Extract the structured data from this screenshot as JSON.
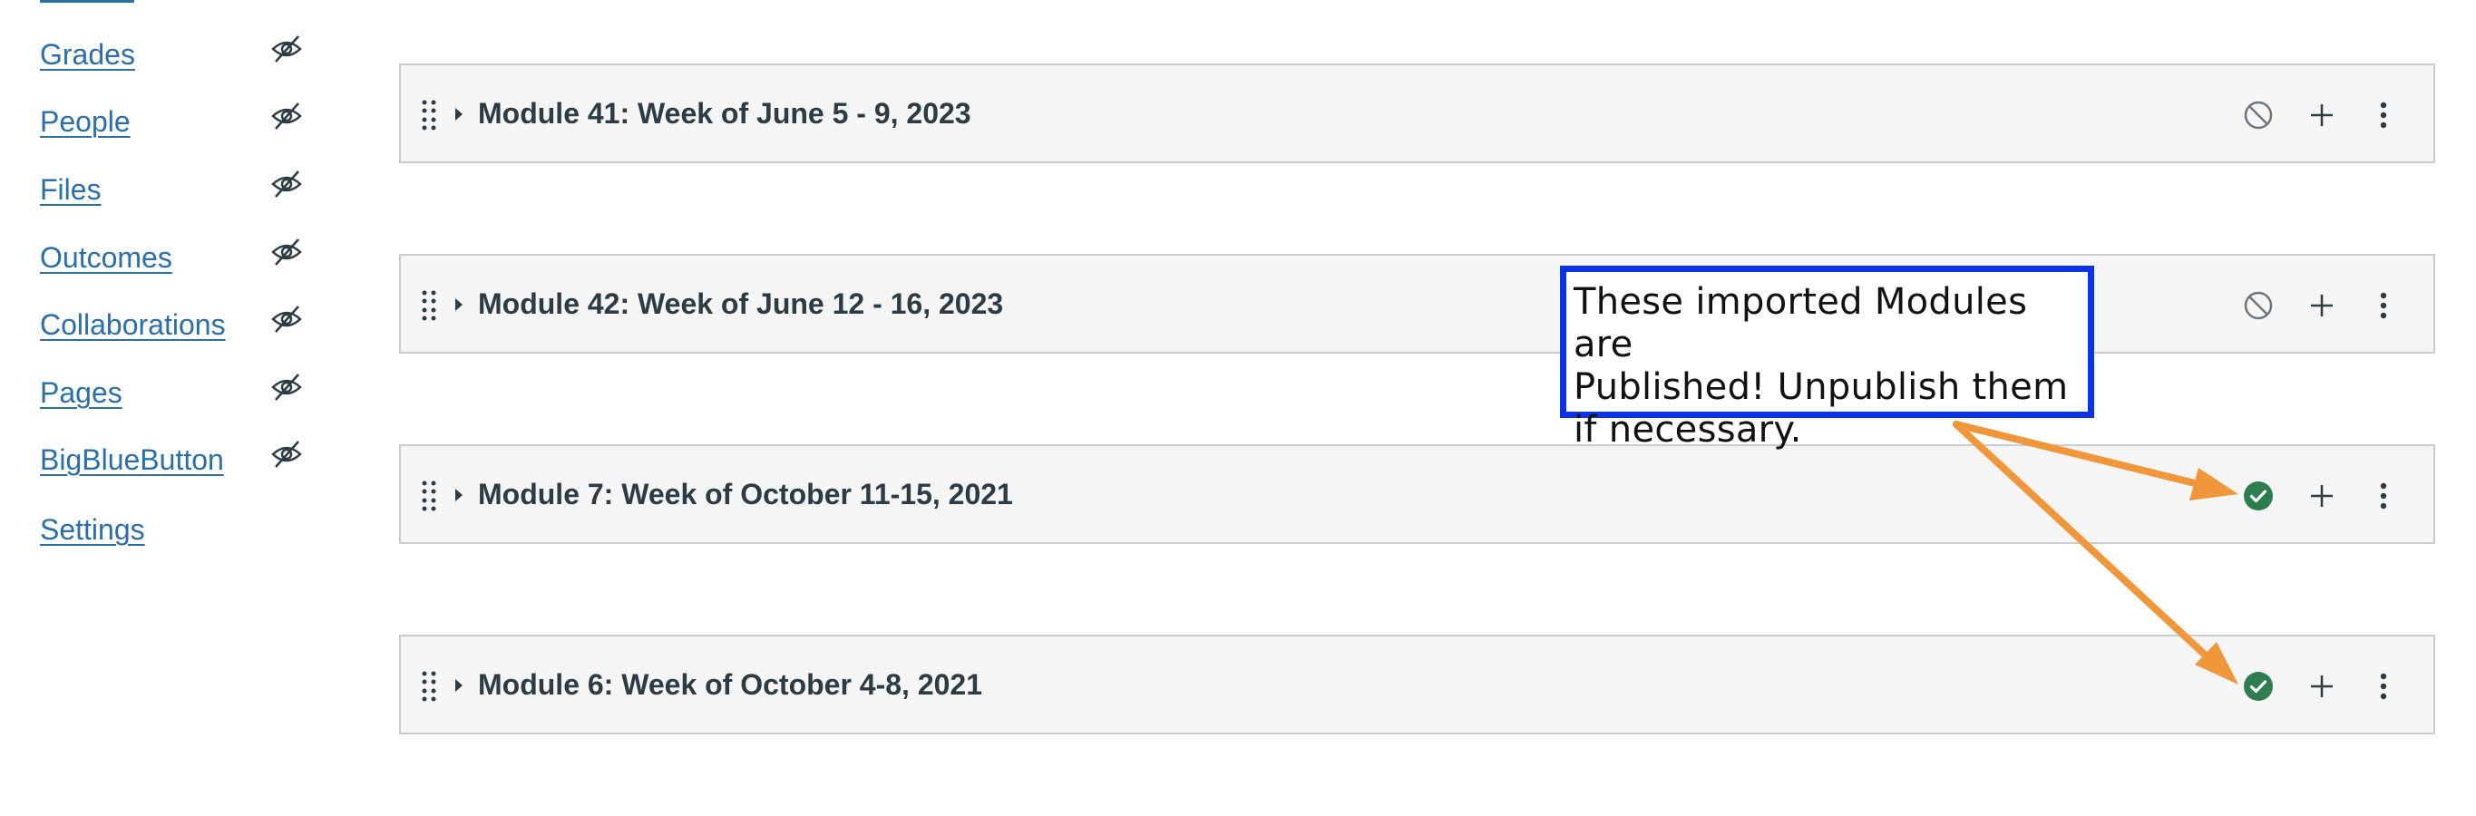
{
  "sidebar": {
    "items": [
      {
        "label": "Grades",
        "hidden_icon": "eye-slash-icon"
      },
      {
        "label": "People",
        "hidden_icon": "eye-slash-icon"
      },
      {
        "label": "Files",
        "hidden_icon": "eye-slash-icon"
      },
      {
        "label": "Outcomes",
        "hidden_icon": "eye-slash-icon"
      },
      {
        "label": "Collaborations",
        "hidden_icon": "eye-slash-icon"
      },
      {
        "label": "Pages",
        "hidden_icon": "eye-slash-icon"
      },
      {
        "label": "BigBlueButton",
        "hidden_icon": "eye-slash-icon"
      },
      {
        "label": "Settings"
      }
    ]
  },
  "modules": [
    {
      "title": "Module 41: Week of June 5 - 9, 2023",
      "status": "unpublished"
    },
    {
      "title": "Module 42: Week of June 12 - 16, 2023",
      "status": "unpublished"
    },
    {
      "title": "Module 7: Week of October 11-15, 2021",
      "status": "published"
    },
    {
      "title": "Module 6: Week of October 4-8, 2021",
      "status": "published"
    }
  ],
  "annotation": {
    "lines": [
      "These imported Modules are",
      "Published! Unpublish them",
      "if necessary."
    ]
  },
  "colors": {
    "link": "#2b6ea8",
    "published": "#2e7d4f",
    "annotation_border": "#0b33e6",
    "arrow": "#f0973b"
  }
}
